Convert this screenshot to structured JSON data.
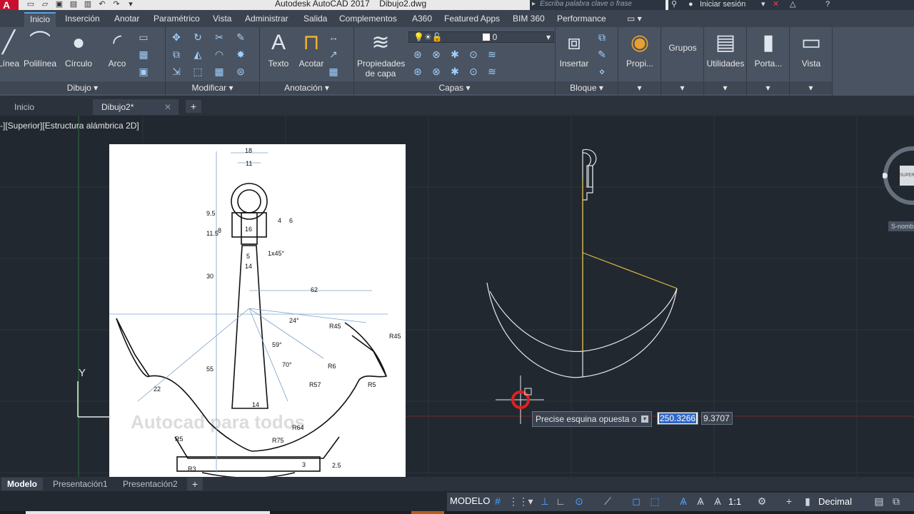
{
  "window": {
    "title": "Autodesk AutoCAD 2017    Dibujo2.dwg",
    "logo": "A"
  },
  "search": {
    "placeholder": "Escriba palabra clave o frase"
  },
  "account": {
    "signin": "Iniciar sesión"
  },
  "ribbon_tabs": [
    "Inicio",
    "Inserción",
    "Anotar",
    "Paramétrico",
    "Vista",
    "Administrar",
    "Salida",
    "Complementos",
    "A360",
    "Featured Apps",
    "BIM 360",
    "Performance"
  ],
  "draw_panel": {
    "title": "Dibujo",
    "buttons": [
      "Línea",
      "Polilínea",
      "Círculo",
      "Arco"
    ]
  },
  "modify_panel": {
    "title": "Modificar"
  },
  "annotation_panel": {
    "title": "Anotación",
    "buttons": [
      "Texto",
      "Acotar"
    ]
  },
  "layers_panel": {
    "title": "Capas",
    "properties_button": "Propiedades de capa",
    "current_layer": "0"
  },
  "block_panel": {
    "title": "Bloque",
    "insert_button": "Insertar"
  },
  "extra_buttons": [
    "Propi...",
    "Grupos",
    "Utilidades",
    "Porta...",
    "Vista"
  ],
  "doc_tabs": {
    "home": "Inicio",
    "current": "Dibujo2*"
  },
  "viewport": {
    "label": "-][Superior][Estructura alámbrica 2D]",
    "viewcube_face": "SUPERIOR",
    "wcs": "S-nombre"
  },
  "ucs": {
    "y_label": "Y"
  },
  "reference_image": {
    "dims": [
      "18",
      "11",
      "9.5",
      "11.5",
      "8",
      "16",
      "4",
      "6",
      "5",
      "1x45°",
      "14",
      "30",
      "62",
      "24°",
      "R45",
      "R45",
      "55",
      "59°",
      "70°",
      "R6",
      "R57",
      "R5",
      "22",
      "14",
      "R64",
      "R75",
      "R5",
      "R3",
      "3",
      "2.5"
    ],
    "watermark": "Autocad para todos"
  },
  "dynamic_input": {
    "prompt": "Precise esquina opuesta o",
    "value_x": "250.3266",
    "value_y": "9.3707"
  },
  "layout_tabs": [
    "Modelo",
    "Presentación1",
    "Presentación2"
  ],
  "status": {
    "space": "MODELO",
    "scale": "1:1",
    "units": "Decimal"
  }
}
